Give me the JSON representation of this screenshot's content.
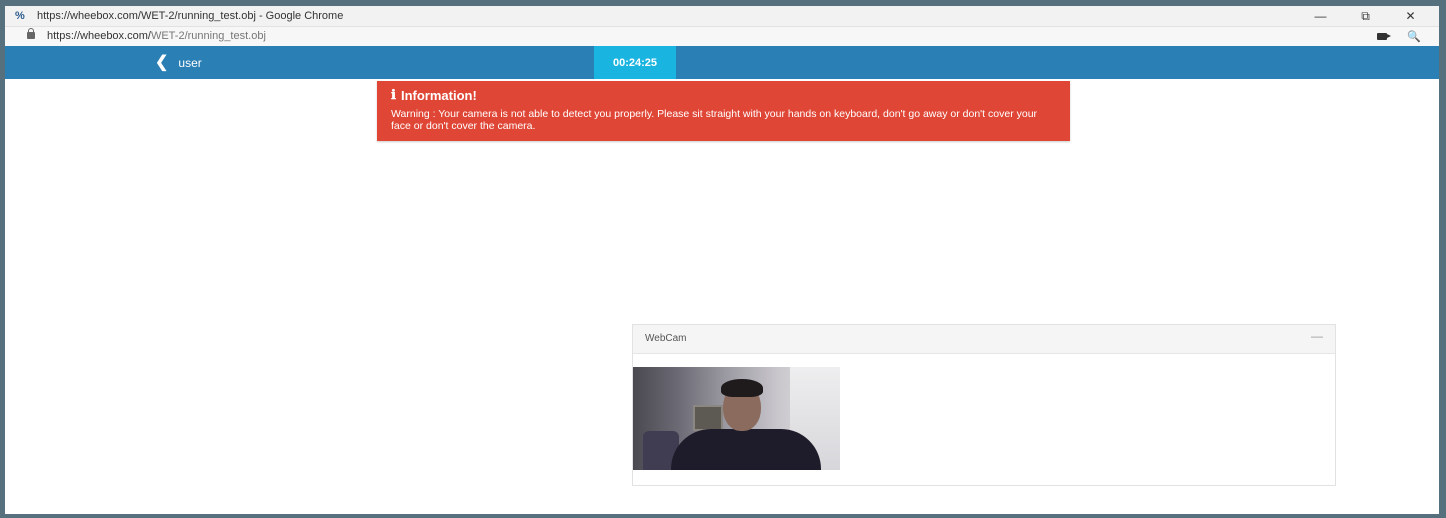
{
  "browser": {
    "window_title": "https://wheebox.com/WET-2/running_test.obj - Google Chrome",
    "url_host": "https://wheebox.com/",
    "url_path": "WET-2/running_test.obj",
    "controls": {
      "minimize": "—",
      "restore": "⧉",
      "close": "✕"
    },
    "zoom_glyph": "🔍"
  },
  "navbar": {
    "back_chevron": "❮",
    "back_label": "user",
    "timer": "00:24:25"
  },
  "alert": {
    "icon": "ℹ",
    "title": "Information!",
    "message": "Warning : Your camera is not able to detect you properly. Please sit straight with your hands on keyboard, don't go away or don't cover your face or don't cover the camera."
  },
  "webcam": {
    "title": "WebCam",
    "collapse_glyph": "—"
  },
  "colors": {
    "navbar": "#2a7fb5",
    "timer": "#19b4e0",
    "alert": "#df4636"
  }
}
